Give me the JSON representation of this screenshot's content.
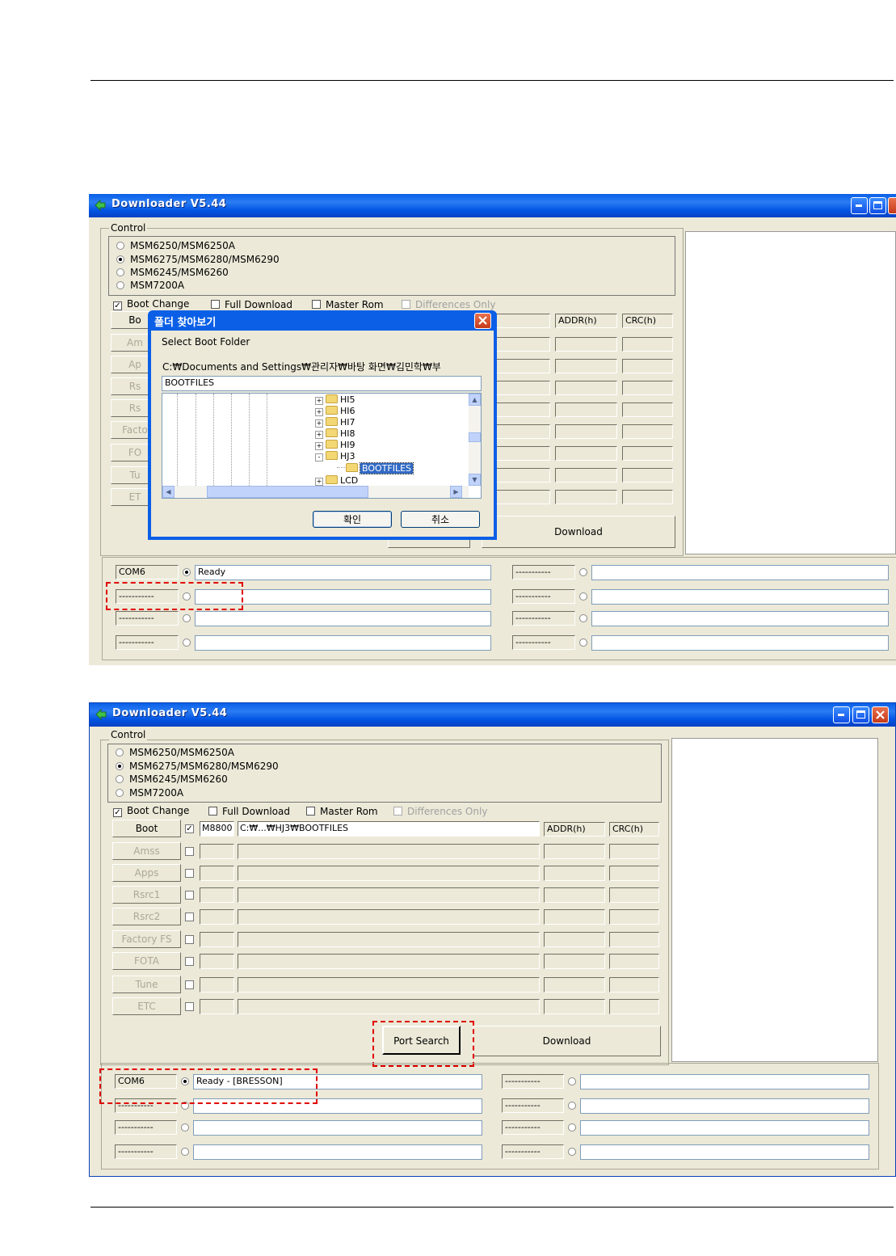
{
  "window_top": {
    "title": "Downloader V5.44",
    "control_legend": "Control",
    "chipsets": [
      {
        "label": "MSM6250/MSM6250A",
        "selected": false
      },
      {
        "label": "MSM6275/MSM6280/MSM6290",
        "selected": true
      },
      {
        "label": "MSM6245/MSM6260",
        "selected": false
      },
      {
        "label": "MSM7200A",
        "selected": false
      }
    ],
    "options": {
      "boot_change": "Boot Change",
      "full_download": "Full Download",
      "master_rom": "Master Rom",
      "differences_only": "Differences Only"
    },
    "buttons": [
      "Bo",
      "Am",
      "Ap",
      "Rs",
      "Rs",
      "Facto",
      "FO",
      "Tu",
      "ET"
    ],
    "addr_header": "ADDR(h)",
    "crc_header": "CRC(h)",
    "download_label": "Download",
    "ports_left": [
      {
        "label": "COM6",
        "status": "Ready",
        "selected": true
      },
      {
        "label": "-----------",
        "status": "",
        "selected": false
      },
      {
        "label": "-----------",
        "status": "",
        "selected": false
      },
      {
        "label": "-----------",
        "status": "",
        "selected": false
      }
    ],
    "ports_right": [
      {
        "label": "-----------",
        "status": ""
      },
      {
        "label": "-----------",
        "status": ""
      },
      {
        "label": "-----------",
        "status": ""
      },
      {
        "label": "-----------",
        "status": ""
      }
    ]
  },
  "dialog": {
    "title": "폴더 찾아보기",
    "prompt": "Select Boot Folder",
    "path": "C:₩Documents and Settings₩관리자₩바탕 화면₩김민학₩부",
    "folder_name": "BOOTFILES",
    "tree": [
      {
        "label": "HI5",
        "expander": "+"
      },
      {
        "label": "HI6",
        "expander": "+"
      },
      {
        "label": "HI7",
        "expander": "+"
      },
      {
        "label": "HI8",
        "expander": "+"
      },
      {
        "label": "HI9",
        "expander": "+"
      },
      {
        "label": "HJ3",
        "expander": "-"
      },
      {
        "label": "BOOTFILES",
        "expander": "",
        "selected": true
      },
      {
        "label": "LCD",
        "expander": "+"
      }
    ],
    "ok_label": "확인",
    "cancel_label": "취소"
  },
  "window_bottom": {
    "title": "Downloader V5.44",
    "control_legend": "Control",
    "chipsets": [
      {
        "label": "MSM6250/MSM6250A",
        "selected": false
      },
      {
        "label": "MSM6275/MSM6280/MSM6290",
        "selected": true
      },
      {
        "label": "MSM6245/MSM6260",
        "selected": false
      },
      {
        "label": "MSM7200A",
        "selected": false
      }
    ],
    "options": {
      "boot_change": "Boot Change",
      "full_download": "Full Download",
      "master_rom": "Master Rom",
      "differences_only": "Differences Only"
    },
    "rows": [
      {
        "button": "Boot",
        "enabled": true,
        "checked": true,
        "model": "M8800",
        "path": "C:₩...₩HJ3₩BOOTFILES",
        "addr": "ADDR(h)",
        "crc": "CRC(h)"
      },
      {
        "button": "Amss",
        "enabled": false,
        "checked": false,
        "model": "",
        "path": "",
        "addr": "",
        "crc": ""
      },
      {
        "button": "Apps",
        "enabled": false,
        "checked": false,
        "model": "",
        "path": "",
        "addr": "",
        "crc": ""
      },
      {
        "button": "Rsrc1",
        "enabled": false,
        "checked": false,
        "model": "",
        "path": "",
        "addr": "",
        "crc": ""
      },
      {
        "button": "Rsrc2",
        "enabled": false,
        "checked": false,
        "model": "",
        "path": "",
        "addr": "",
        "crc": ""
      },
      {
        "button": "Factory FS",
        "enabled": false,
        "checked": false,
        "model": "",
        "path": "",
        "addr": "",
        "crc": ""
      },
      {
        "button": "FOTA",
        "enabled": false,
        "checked": false,
        "model": "",
        "path": "",
        "addr": "",
        "crc": ""
      },
      {
        "button": "Tune",
        "enabled": false,
        "checked": false,
        "model": "",
        "path": "",
        "addr": "",
        "crc": ""
      },
      {
        "button": "ETC",
        "enabled": false,
        "checked": false,
        "model": "",
        "path": "",
        "addr": "",
        "crc": ""
      }
    ],
    "port_search_label": "Port Search",
    "download_label": "Download",
    "ports_left": [
      {
        "label": "COM6",
        "status": "Ready - [BRESSON]",
        "selected": true
      },
      {
        "label": "-----------",
        "status": "",
        "selected": false
      },
      {
        "label": "-----------",
        "status": "",
        "selected": false
      },
      {
        "label": "-----------",
        "status": "",
        "selected": false
      }
    ],
    "ports_right": [
      {
        "label": "-----------",
        "status": ""
      },
      {
        "label": "-----------",
        "status": ""
      },
      {
        "label": "-----------",
        "status": ""
      },
      {
        "label": "-----------",
        "status": ""
      }
    ]
  },
  "colors": {
    "titlebar_blue": "#0A5FE6",
    "window_face": "#ECE9D8",
    "highlight_red": "#E00000",
    "selection_blue": "#316AC5"
  }
}
